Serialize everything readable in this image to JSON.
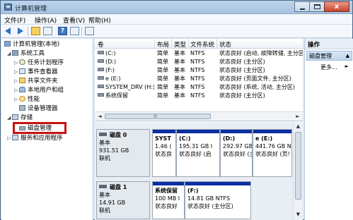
{
  "window": {
    "title": "计算机管理"
  },
  "menu": [
    "文件(F)",
    "操作(A)",
    "查看(V)",
    "帮助(H)"
  ],
  "toolbar": {
    "icons": [
      "back-arrow-icon",
      "forward-arrow-icon",
      "up-folder-icon",
      "show-hide-tree-icon",
      "help-icon",
      "properties-icon",
      "export-icon"
    ],
    "help_glyph": "?"
  },
  "tree": {
    "root": "计算机管理(本地)",
    "system_tools": "系统工具",
    "task_scheduler": "任务计划程序",
    "event_viewer": "事件查看器",
    "shared_folders": "共享文件夹",
    "local_users": "本地用户和组",
    "performance": "性能",
    "device_manager": "设备管理器",
    "storage": "存储",
    "disk_management": "磁盘管理",
    "services": "服务和应用程序"
  },
  "volume_list": {
    "columns": [
      "卷",
      "布局",
      "类型",
      "文件系统",
      "状态"
    ],
    "rows": [
      {
        "volume": "(C:)",
        "layout": "简单",
        "type": "基本",
        "fs": "NTFS",
        "status": "状态良好 (启动, 故障转储, 主分区)"
      },
      {
        "volume": "(D:)",
        "layout": "简单",
        "type": "基本",
        "fs": "NTFS",
        "status": "状态良好 (主分区)"
      },
      {
        "volume": "(F:)",
        "layout": "简单",
        "type": "基本",
        "fs": "NTFS",
        "status": "状态良好 (主分区)"
      },
      {
        "volume": "e (E:)",
        "layout": "简单",
        "type": "基本",
        "fs": "NTFS",
        "status": "状态良好 (页面文件, 主分区)"
      },
      {
        "volume": "SYSTEM_DRV (H:)",
        "layout": "简单",
        "type": "基本",
        "fs": "NTFS",
        "status": "状态良好 (系统, 活动, 主分区)"
      },
      {
        "volume": "系统保留",
        "layout": "简单",
        "type": "基本",
        "fs": "NTFS",
        "status": "状态良好 (主分区)"
      }
    ],
    "scroll_grip": "III"
  },
  "disks": [
    {
      "name": "磁盘 0",
      "type": "基本",
      "size": "931.51 GB",
      "state": "联机",
      "partitions": [
        {
          "name": "SYST",
          "size": "1.46 (",
          "status": "状态良"
        },
        {
          "name": "(C:)",
          "size": "195.31 GB I",
          "status": "状态良好 (启"
        },
        {
          "name": "(D:)",
          "size": "292.97 GB I",
          "status": "状态良好 (主"
        },
        {
          "name": "e (E:)",
          "size": "441.76 GB N",
          "status": "状态良好 (页!"
        }
      ]
    },
    {
      "name": "磁盘 1",
      "type": "基本",
      "size": "14.91 GB",
      "state": "联机",
      "partitions": [
        {
          "name": "系统保留",
          "size": "100 MB I",
          "status": "状态良好"
        },
        {
          "name": "(F:)",
          "size": "14.81 GB NTFS",
          "status": "状态良好 (主分区)"
        }
      ]
    }
  ],
  "actions": {
    "header": "操作",
    "section": "磁盘管理",
    "more": "更多..."
  },
  "scroll_glyphs": {
    "left": "◄",
    "right": "►",
    "up": "▲",
    "down": "▼",
    "collapse": "▲",
    "more_arrow": "►"
  }
}
